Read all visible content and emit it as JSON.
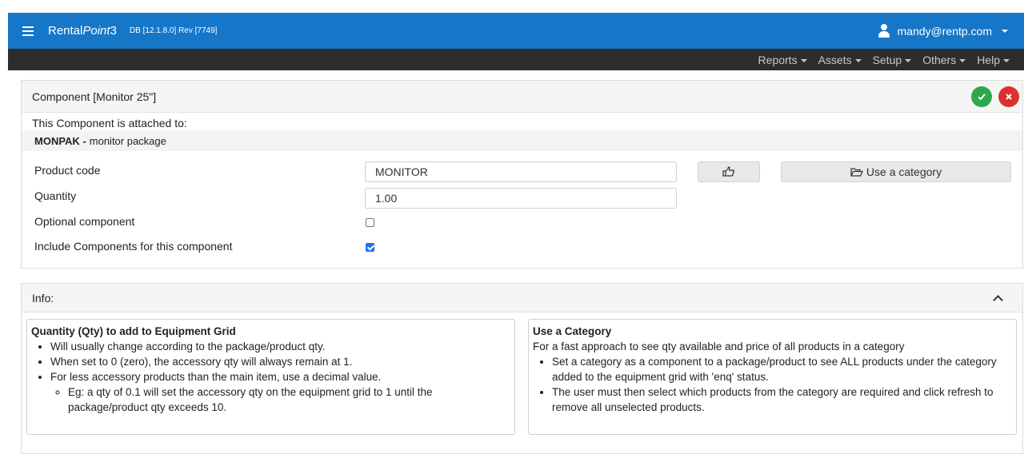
{
  "topbar": {
    "brand_prefix": "Rental",
    "brand_italic": "Point",
    "brand_suffix": "3",
    "version": "DB [12.1.8.0]  Rev [7749]",
    "user": "mandy@rentp.com"
  },
  "nav": [
    "Reports",
    "Assets",
    "Setup",
    "Others",
    "Help"
  ],
  "panel": {
    "title": "Component [Monitor 25\"]",
    "attached_label": "This Component is attached to:",
    "attached_code": "MONPAK -",
    "attached_desc": "monitor package",
    "fields": {
      "product_code_label": "Product code",
      "product_code_value": "MONITOR",
      "quantity_label": "Quantity",
      "quantity_value": "1.00",
      "optional_label": "Optional component",
      "optional_checked": false,
      "include_label": "Include Components for this component",
      "include_checked": true
    },
    "use_category_label": "Use a category"
  },
  "info": {
    "title": "Info:",
    "left": {
      "heading": "Quantity (Qty) to add to Equipment Grid",
      "items": [
        "Will usually change according to the package/product qty.",
        "When set to 0 (zero), the accessory qty will always remain at 1.",
        "For less accessory products than the main item, use a decimal value."
      ],
      "subitem": "Eg: a qty of 0.1 will set the accessory qty on the equipment grid to 1 until the package/product qty exceeds 10."
    },
    "right": {
      "heading": "Use a Category",
      "intro": "For a fast approach to see qty available and price of all products in a category",
      "items": [
        "Set a category as a component to a package/product to see ALL products under the category added to the equipment grid with 'enq' status.",
        "The user must then select which products from the category are required and click refresh to remove all unselected products."
      ]
    }
  },
  "colors": {
    "topbar": "#1676c8",
    "navbar": "#2d2d2d",
    "ok": "#2ea84a",
    "cancel": "#d9332f"
  }
}
